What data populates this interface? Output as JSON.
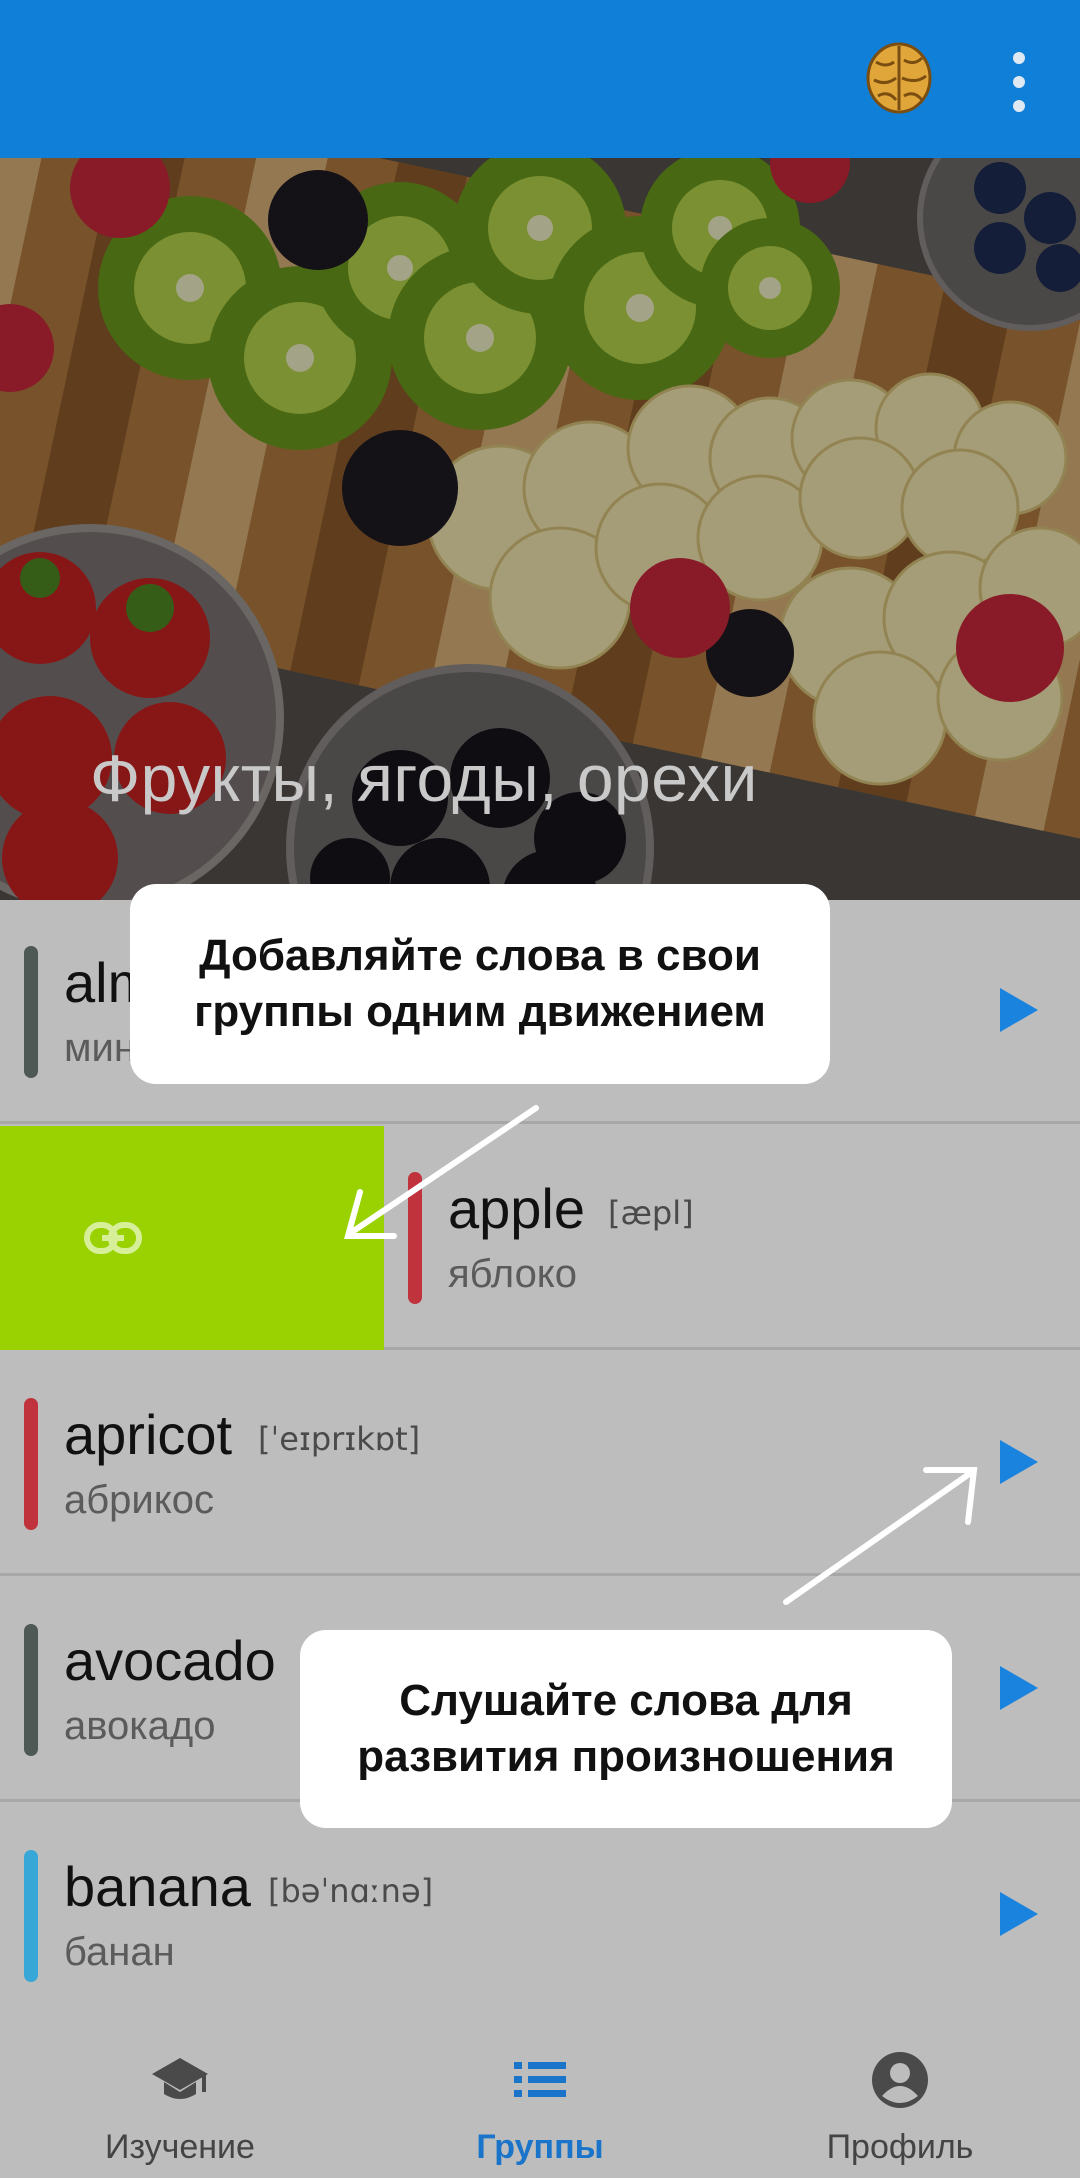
{
  "app": {
    "brain_icon": "brain-icon",
    "menu_icon": "more-vert-icon",
    "appbar_color": "#0f7fd8"
  },
  "hero": {
    "title": "Фрукты, ягоды, орехи"
  },
  "words": [
    {
      "word": "alm",
      "translation": "мин",
      "ipa": "",
      "bar_color": "#4e5854"
    },
    {
      "word": "apple",
      "translation": "яблоко",
      "ipa": "[æpl]",
      "bar_color": "#c0333d"
    },
    {
      "word": "apricot",
      "translation": "абрикос",
      "ipa": "[ˈeɪprɪkɒt]",
      "bar_color": "#c0333d"
    },
    {
      "word": "avocado",
      "translation": "авокадо",
      "ipa": "",
      "bar_color": "#4e5854"
    },
    {
      "word": "banana",
      "translation": "банан",
      "ipa": "[bəˈnɑːnə]",
      "bar_color": "#36a7d6"
    }
  ],
  "swipe_action": {
    "icon": "link-icon",
    "color": "#99d200"
  },
  "tooltips": {
    "add": {
      "line1": "Добавляйте слова в свои",
      "line2": "группы одним движением"
    },
    "listen": {
      "line1": "Слушайте слова для",
      "line2": "развития произношения"
    }
  },
  "nav": [
    {
      "label": "Изучение",
      "icon": "graduation-cap-icon"
    },
    {
      "label": "Группы",
      "icon": "list-icon"
    },
    {
      "label": "Профиль",
      "icon": "account-circle-icon"
    }
  ],
  "accent_color": "#1a83dd"
}
